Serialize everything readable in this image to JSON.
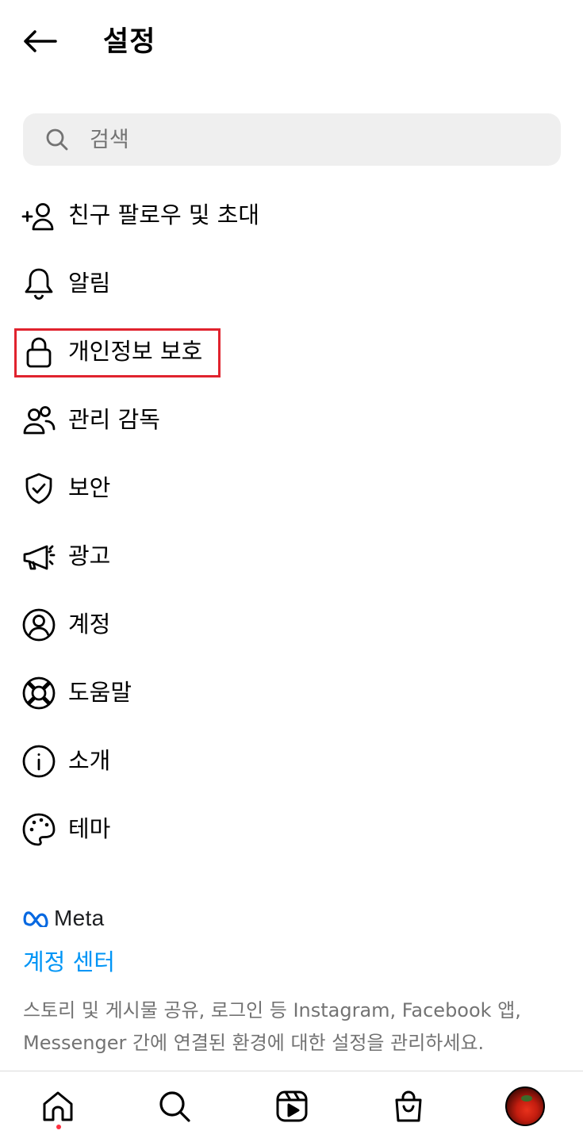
{
  "header": {
    "title": "설정"
  },
  "search": {
    "placeholder": "검색"
  },
  "menu": {
    "items": [
      {
        "label": "친구 팔로우 및 초대",
        "icon": "add-friend-icon"
      },
      {
        "label": "알림",
        "icon": "bell-icon"
      },
      {
        "label": "개인정보 보호",
        "icon": "lock-icon",
        "highlighted": true
      },
      {
        "label": "관리 감독",
        "icon": "supervision-icon"
      },
      {
        "label": "보안",
        "icon": "shield-check-icon"
      },
      {
        "label": "광고",
        "icon": "megaphone-icon"
      },
      {
        "label": "계정",
        "icon": "account-circle-icon"
      },
      {
        "label": "도움말",
        "icon": "lifebuoy-icon"
      },
      {
        "label": "소개",
        "icon": "info-icon"
      },
      {
        "label": "테마",
        "icon": "palette-icon"
      }
    ]
  },
  "meta": {
    "logo_text": "Meta",
    "accounts_center": "계정 센터",
    "description": "스토리 및 게시물 공유, 로그인 등 Instagram, Facebook 앱, Messenger 간에 연결된 환경에 대한 설정을 관리하세요."
  },
  "tabbar": {
    "items": [
      "home-icon",
      "search-icon",
      "reels-icon",
      "shop-icon",
      "profile-avatar"
    ]
  },
  "colors": {
    "accent": "#0095f6",
    "highlight_border": "#e0232e",
    "notification_dot": "#ff3040",
    "muted_text": "#737373"
  }
}
